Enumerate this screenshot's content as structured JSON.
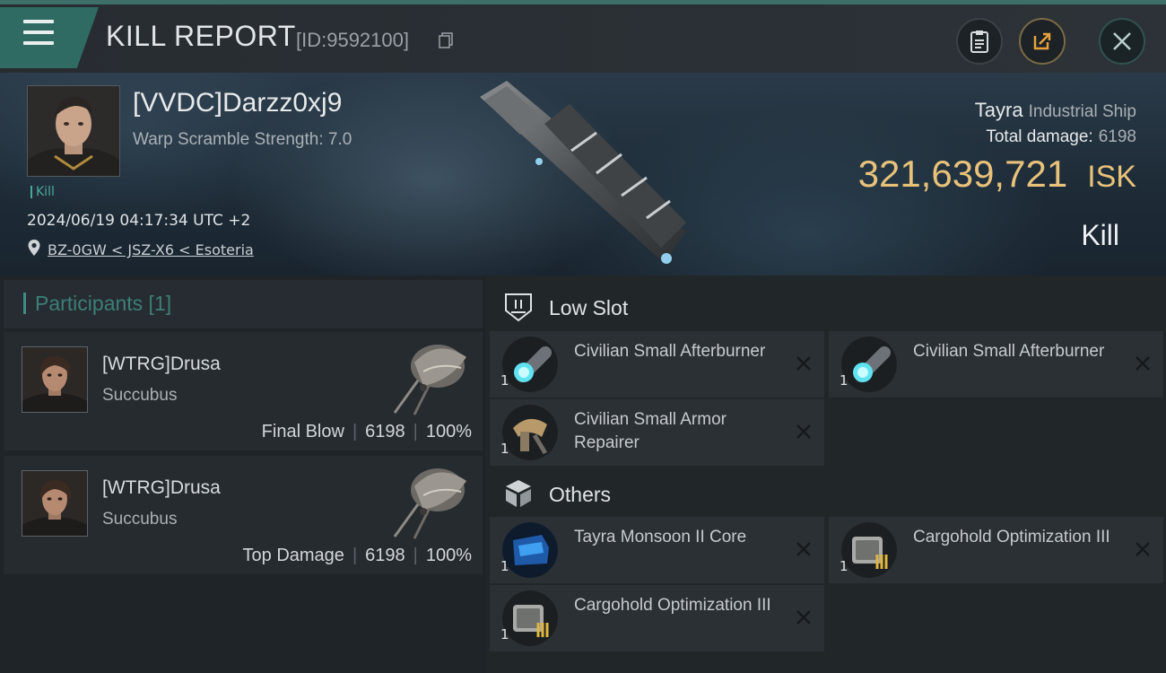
{
  "header": {
    "title": "KILL REPORT",
    "report_id": "[ID:9592100]"
  },
  "victim": {
    "name": "[VVDC]Darzz0xj9",
    "warp_scramble": "Warp Scramble Strength: 7.0",
    "tag": "Kill",
    "datetime": "2024/06/19 04:17:34 UTC +2",
    "location": "BZ-0GW < JSZ-X6 < Esoteria",
    "ship_name": "Tayra",
    "ship_class": "Industrial Ship",
    "total_damage_label": "Total damage:",
    "total_damage": "6198",
    "isk_value": "321,639,721",
    "isk_unit": "ISK",
    "result": "Kill"
  },
  "participants": {
    "title": "Participants [1]",
    "rows": [
      {
        "name": "[WTRG]Drusa",
        "ship": "Succubus",
        "role": "Final Blow",
        "damage": "6198",
        "percent": "100%"
      },
      {
        "name": "[WTRG]Drusa",
        "ship": "Succubus",
        "role": "Top Damage",
        "damage": "6198",
        "percent": "100%"
      }
    ]
  },
  "sections": {
    "low_slot": {
      "title": "Low Slot",
      "items": [
        {
          "name": "Civilian Small Afterburner",
          "qty": "1"
        },
        {
          "name": "Civilian Small Afterburner",
          "qty": "1"
        },
        {
          "name": "Civilian Small Armor Repairer",
          "qty": "1"
        }
      ]
    },
    "others": {
      "title": "Others",
      "items": [
        {
          "name": "Tayra Monsoon II Core",
          "qty": "1"
        },
        {
          "name": "Cargohold Optimization III",
          "qty": "1"
        },
        {
          "name": "Cargohold Optimization III",
          "qty": "1"
        }
      ]
    }
  },
  "colors": {
    "accent_teal": "#2f6b62",
    "isk_gold": "#e8c27a",
    "participants_teal": "#3d7f77"
  }
}
